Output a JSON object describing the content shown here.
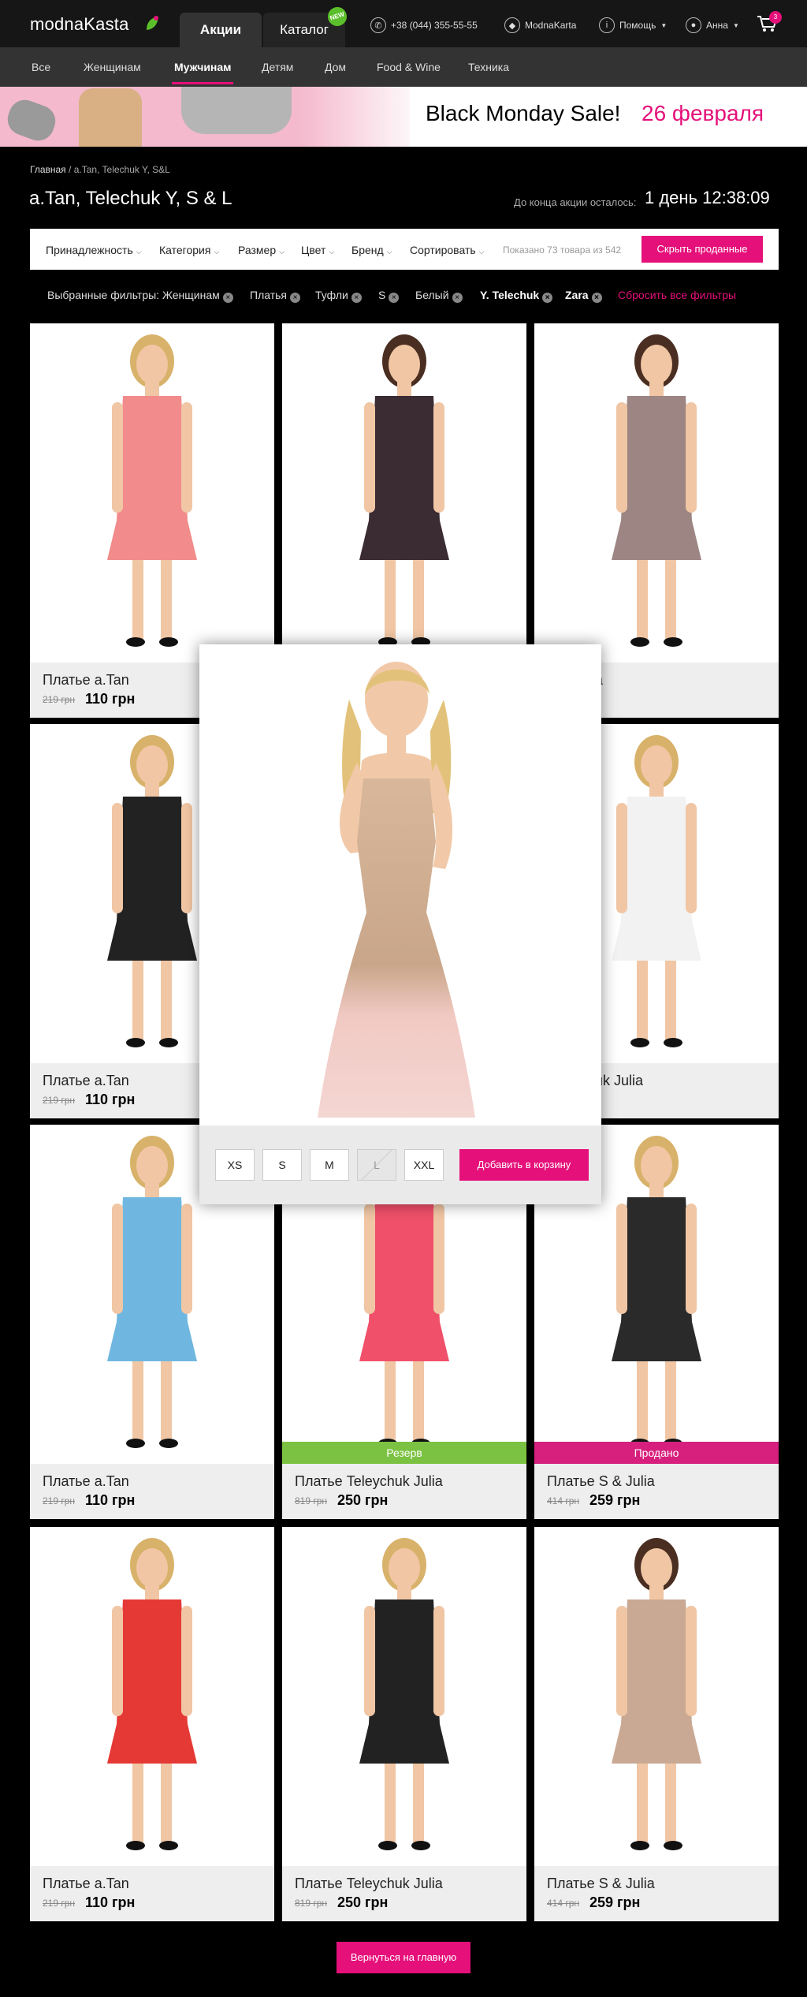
{
  "header": {
    "logo_main": "modna",
    "logo_second": "Kasta",
    "tabs": [
      {
        "label": "Акции"
      },
      {
        "label": "Каталог"
      }
    ],
    "new_badge": "NEW",
    "phone": "+38 (044) 355-55-55",
    "card_label": "ModnaKarta",
    "help_label": "Помощь",
    "user_label": "Анна",
    "cart_count": "3",
    "icons": [
      "phone-icon",
      "card-icon",
      "info-icon",
      "user-icon",
      "cart-icon"
    ]
  },
  "nav": {
    "items": [
      {
        "label": "Все"
      },
      {
        "label": "Женщинам"
      },
      {
        "label": "Мужчинам"
      },
      {
        "label": "Детям"
      },
      {
        "label": "Дом"
      },
      {
        "label": "Food & Wine"
      },
      {
        "label": "Техника"
      }
    ],
    "active": "Мужчинам"
  },
  "banner": {
    "text": "Black Monday Sale!",
    "date": "26 февраля"
  },
  "breadcrumb": {
    "home": "Главная",
    "separator": "/",
    "current": "a.Tan, Telechuk Y, S&L"
  },
  "page": {
    "title": "a.Tan, Telechuk Y, S & L",
    "countdown_label": "До конца акции осталось:",
    "countdown": "1 день 12:38:09"
  },
  "filters": {
    "items": [
      {
        "label": "Принадлежность"
      },
      {
        "label": "Категория"
      },
      {
        "label": "Размер"
      },
      {
        "label": "Цвет"
      },
      {
        "label": "Бренд"
      },
      {
        "label": "Сортировать"
      }
    ],
    "shown": "Показано 73 товара из 542",
    "hide_sold": "Скрыть проданные",
    "selected_label": "Выбранные фильтры:",
    "chips": [
      {
        "label": "Женщинам"
      },
      {
        "label": "Платья"
      },
      {
        "label": "Туфли"
      },
      {
        "label": "S"
      },
      {
        "label": "Белый"
      },
      {
        "label": "Y. Telechuk"
      },
      {
        "label": "Zara"
      }
    ],
    "reset": "Сбросить все фильтры"
  },
  "products": [
    {
      "name": "Платье a.Tan",
      "old": "219 грн",
      "price": "110 грн",
      "status": ""
    },
    {
      "name": "",
      "old": "",
      "price": "",
      "status": ""
    },
    {
      "name": "S & Julia",
      "old": "",
      "price": "59 грн",
      "status": ""
    },
    {
      "name": "Платье a.Tan",
      "old": "219 грн",
      "price": "110 грн",
      "status": ""
    },
    {
      "name": "",
      "old": "",
      "price": "",
      "status": ""
    },
    {
      "name": "Teleychuk Julia",
      "old": "",
      "price": "50 грн",
      "status": ""
    },
    {
      "name": "Платье a.Tan",
      "old": "219 грн",
      "price": "110 грн",
      "status": ""
    },
    {
      "name": "Платье Teleychuk Julia",
      "old": "819 грн",
      "price": "250 грн",
      "status": "Резерв"
    },
    {
      "name": "Платье S & Julia",
      "old": "414 грн",
      "price": "259 грн",
      "status": "Продано"
    },
    {
      "name": "Платье a.Tan",
      "old": "219 грн",
      "price": "110 грн",
      "status": ""
    },
    {
      "name": "Платье Teleychuk Julia",
      "old": "819 грн",
      "price": "250 грн",
      "status": ""
    },
    {
      "name": "Платье S & Julia",
      "old": "414 грн",
      "price": "259 грн",
      "status": ""
    }
  ],
  "status_colors": {
    "reserve": "#7cc242",
    "sold": "#d7207d"
  },
  "quickview": {
    "sizes": [
      {
        "label": "XS",
        "available": true
      },
      {
        "label": "S",
        "available": true
      },
      {
        "label": "M",
        "available": true
      },
      {
        "label": "L",
        "available": false
      },
      {
        "label": "XXL",
        "available": true
      }
    ],
    "add_to_cart": "Добавить в корзину"
  },
  "footer": {
    "back_home": "Вернуться на главную"
  },
  "colors": {
    "accent": "#e5107a",
    "header": "#161616",
    "nav": "#333333"
  }
}
